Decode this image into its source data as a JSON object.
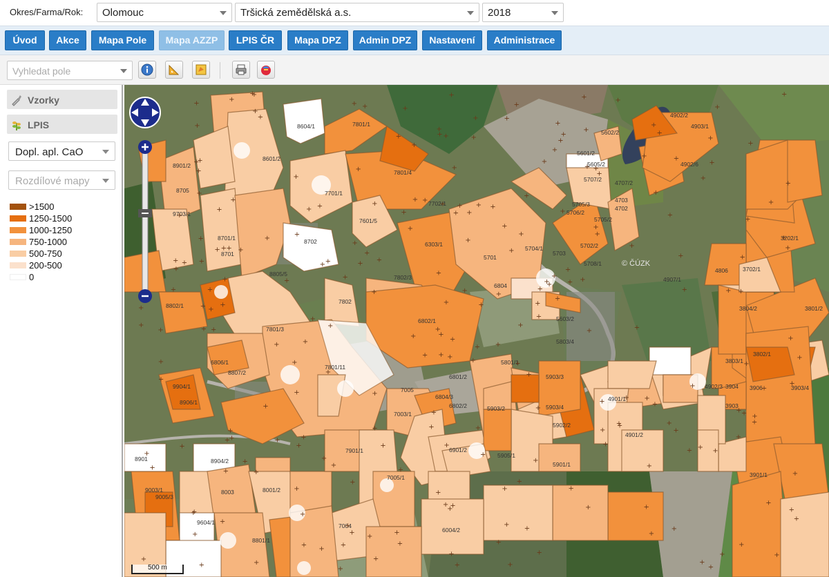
{
  "selectors": {
    "label": "Okres/Farma/Rok:",
    "district": "Olomouc",
    "farm": "Tršická zemědělská a.s.",
    "year": "2018"
  },
  "nav": {
    "uvod": "Úvod",
    "akce": "Akce",
    "mapa_pole": "Mapa Pole",
    "mapa_azzp": "Mapa AZZP",
    "lpis_cr": "LPIS ČR",
    "mapa_dpz": "Mapa DPZ",
    "admin_dpz": "Admin DPZ",
    "nastaveni": "Nastavení",
    "administrace": "Administrace"
  },
  "toolbar": {
    "search_placeholder": "Vyhledat pole"
  },
  "sidebar": {
    "samples": "Vzorky",
    "lpis": "LPIS",
    "layer_select": "Dopl. apl. CaO",
    "diff_select": "Rozdílové mapy"
  },
  "legend": [
    {
      "label": ">1500",
      "color": "#a3520e"
    },
    {
      "label": "1250-1500",
      "color": "#e56f10"
    },
    {
      "label": "1000-1250",
      "color": "#f2913c"
    },
    {
      "label": "750-1000",
      "color": "#f6b57e"
    },
    {
      "label": "500-750",
      "color": "#f9cda4"
    },
    {
      "label": "200-500",
      "color": "#fbe1cc"
    },
    {
      "label": "0",
      "color": "#ffffff"
    }
  ],
  "map": {
    "watermark": "© ČÚZK",
    "scale": "500 m",
    "field_labels": [
      "8604/1",
      "7801/1",
      "4902/2",
      "4903/1",
      "5602/2",
      "5601/2",
      "5605/2",
      "4902/6",
      "5707/2",
      "8901/2",
      "8705",
      "8601/2",
      "7801/4",
      "4707/2",
      "4703",
      "4702",
      "9703/1",
      "7701/1",
      "7702/1",
      "5705/3",
      "5706/2",
      "5705/2",
      "7601/5",
      "6303/1",
      "8701/1",
      "8702",
      "5702/2",
      "5701",
      "5704/1",
      "5703",
      "5708/1",
      "3202/1",
      "8701",
      "4806",
      "3702/1",
      "4907/1",
      "8805/5",
      "7802/3",
      "6804",
      "8802/1",
      "6802/1",
      "5603/2",
      "3804/2",
      "3801/2",
      "7801/3",
      "7802",
      "5801/1",
      "5803/4",
      "6806/1",
      "3803/1",
      "3802/1",
      "8807/2",
      "7801/11",
      "6801/2",
      "5903/3",
      "4902/3",
      "3904",
      "3903/4",
      "3906",
      "8906/1",
      "7005",
      "5903/4",
      "5902/2",
      "4901/1",
      "3903",
      "9003/1",
      "7003/1",
      "6804/3",
      "6802/2",
      "5903/2",
      "4901/2",
      "9904/1",
      "7901/1",
      "6901/2",
      "5905/1",
      "3901/1",
      "8901",
      "8904/2",
      "8003",
      "8001/2",
      "7005/1",
      "5901/1",
      "9005/3",
      "9604/1",
      "8801/1",
      "6004/2",
      "7004"
    ]
  }
}
